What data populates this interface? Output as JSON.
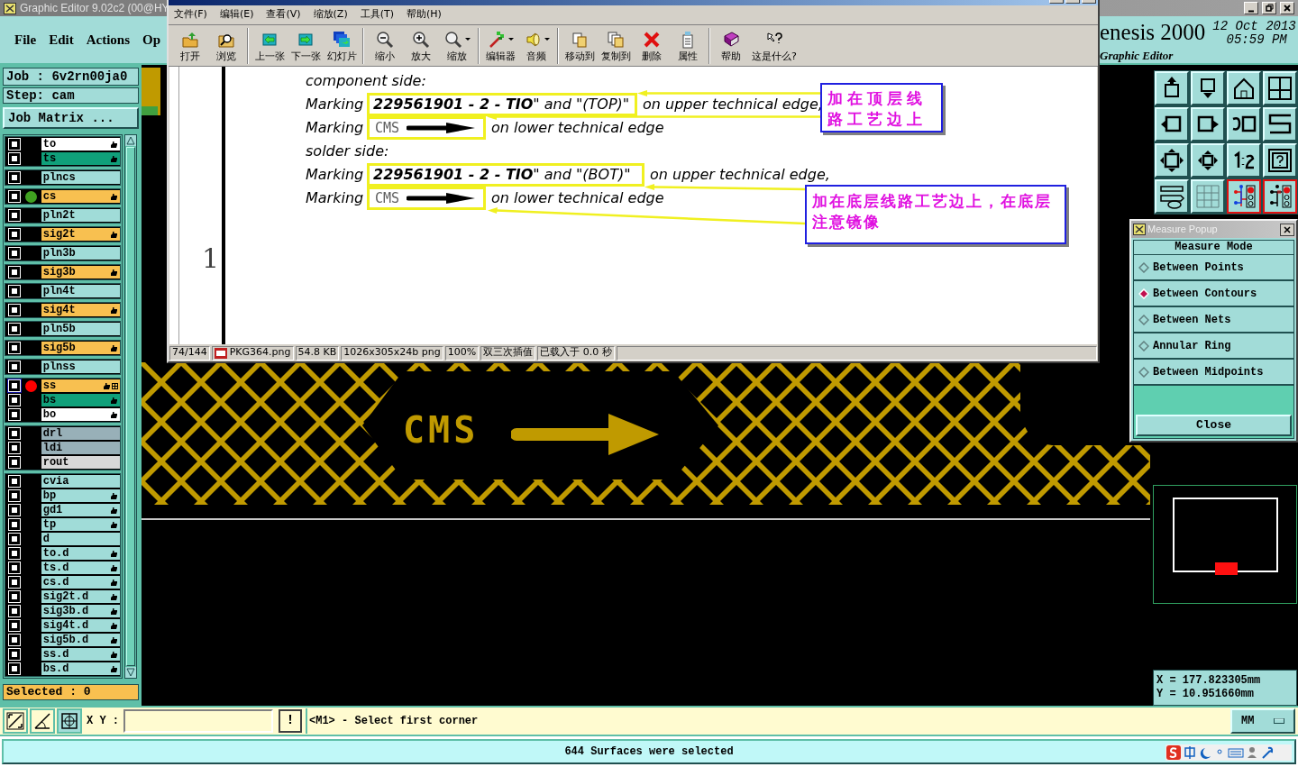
{
  "main_window": {
    "title": "Graphic Editor 9.02c2 (00@HY",
    "menu": [
      "File",
      "Edit",
      "Actions",
      "Op"
    ],
    "product": "enesis 2000",
    "date": "12 Oct 2013",
    "time": "05:59 PM",
    "subtitle": "Graphic Editor"
  },
  "job_panel": {
    "job": "Job : 6v2rn00ja0",
    "step": "Step: cam",
    "matrix_button": "Job Matrix ..."
  },
  "layer_groups": [
    [
      {
        "name": "to",
        "color": "#ffffff",
        "hand": true,
        "extra_icon": false,
        "selected": false
      },
      {
        "name": "ts",
        "color": "#10a07a",
        "hand": true,
        "extra_icon": false,
        "selected": false
      }
    ],
    [
      {
        "name": "plncs",
        "color": "#a0dcd8",
        "hand": false,
        "extra_icon": false,
        "selected": false
      }
    ],
    [
      {
        "name": "cs",
        "color": "#f8c050",
        "hand": true,
        "extra_icon": false,
        "selected": false,
        "dot": {
          "color": "#40a020"
        }
      }
    ],
    [
      {
        "name": "pln2t",
        "color": "#a0dcd8",
        "hand": false,
        "extra_icon": false,
        "selected": false
      }
    ],
    [
      {
        "name": "sig2t",
        "color": "#f8c050",
        "hand": true,
        "extra_icon": false,
        "selected": false
      }
    ],
    [
      {
        "name": "pln3b",
        "color": "#a0dcd8",
        "hand": false,
        "extra_icon": false,
        "selected": false
      }
    ],
    [
      {
        "name": "sig3b",
        "color": "#f8c050",
        "hand": true,
        "extra_icon": false,
        "selected": false
      }
    ],
    [
      {
        "name": "pln4t",
        "color": "#a0dcd8",
        "hand": false,
        "extra_icon": false,
        "selected": false
      }
    ],
    [
      {
        "name": "sig4t",
        "color": "#f8c050",
        "hand": true,
        "extra_icon": false,
        "selected": false
      }
    ],
    [
      {
        "name": "pln5b",
        "color": "#a0dcd8",
        "hand": false,
        "extra_icon": false,
        "selected": false
      }
    ],
    [
      {
        "name": "sig5b",
        "color": "#f8c050",
        "hand": true,
        "extra_icon": false,
        "selected": false
      }
    ],
    [
      {
        "name": "plnss",
        "color": "#a0dcd8",
        "hand": false,
        "extra_icon": false,
        "selected": false
      }
    ],
    [
      {
        "name": "ss",
        "color": "#f8c050",
        "hand": true,
        "extra_icon": true,
        "selected": true,
        "dot": {
          "color": "#ff0000"
        }
      },
      {
        "name": "bs",
        "color": "#10a07a",
        "hand": true,
        "extra_icon": false,
        "selected": false
      },
      {
        "name": "bo",
        "color": "#ffffff",
        "hand": true,
        "extra_icon": false,
        "selected": false
      }
    ],
    [
      {
        "name": "drl",
        "color": "#98b0b8",
        "hand": false,
        "extra_icon": false,
        "selected": false
      },
      {
        "name": "ldi",
        "color": "#98b0b8",
        "hand": false,
        "extra_icon": false,
        "selected": false
      },
      {
        "name": "rout",
        "color": "#d8d8d8",
        "hand": false,
        "extra_icon": false,
        "selected": false
      }
    ],
    [
      {
        "name": "cvia",
        "color": "#a0dcd8",
        "hand": false,
        "extra_icon": false,
        "selected": false
      },
      {
        "name": "bp",
        "color": "#a0dcd8",
        "hand": true,
        "extra_icon": false,
        "selected": false
      },
      {
        "name": "gd1",
        "color": "#a0dcd8",
        "hand": true,
        "extra_icon": false,
        "selected": false
      },
      {
        "name": "tp",
        "color": "#a0dcd8",
        "hand": true,
        "extra_icon": false,
        "selected": false
      },
      {
        "name": "d",
        "color": "#a0dcd8",
        "hand": false,
        "extra_icon": false,
        "selected": false
      },
      {
        "name": "to.d",
        "color": "#a0dcd8",
        "hand": true,
        "extra_icon": false,
        "selected": false
      },
      {
        "name": "ts.d",
        "color": "#a0dcd8",
        "hand": true,
        "extra_icon": false,
        "selected": false
      },
      {
        "name": "cs.d",
        "color": "#a0dcd8",
        "hand": true,
        "extra_icon": false,
        "selected": false
      },
      {
        "name": "sig2t.d",
        "color": "#a0dcd8",
        "hand": true,
        "extra_icon": false,
        "selected": false
      },
      {
        "name": "sig3b.d",
        "color": "#a0dcd8",
        "hand": true,
        "extra_icon": false,
        "selected": false
      },
      {
        "name": "sig4t.d",
        "color": "#a0dcd8",
        "hand": true,
        "extra_icon": false,
        "selected": false
      },
      {
        "name": "sig5b.d",
        "color": "#a0dcd8",
        "hand": true,
        "extra_icon": false,
        "selected": false
      },
      {
        "name": "ss.d",
        "color": "#a0dcd8",
        "hand": true,
        "extra_icon": false,
        "selected": false
      },
      {
        "name": "bs.d",
        "color": "#a0dcd8",
        "hand": true,
        "extra_icon": false,
        "selected": false
      }
    ]
  ],
  "selected_count": "Selected : 0",
  "canvas": {
    "marking": "CMS"
  },
  "tool_buttons": [
    {
      "highlighted": false
    },
    {
      "highlighted": false
    },
    {
      "highlighted": false
    },
    {
      "highlighted": false
    },
    {
      "highlighted": false
    },
    {
      "highlighted": false
    },
    {
      "highlighted": false
    },
    {
      "highlighted": false
    },
    {
      "highlighted": false
    },
    {
      "highlighted": false
    },
    {
      "highlighted": false
    },
    {
      "highlighted": false
    },
    {
      "highlighted": false
    },
    {
      "highlighted": false
    },
    {
      "highlighted": true
    },
    {
      "highlighted": true
    }
  ],
  "coordinates": {
    "x": "X = 177.823305mm",
    "y": "Y = 10.951660mm"
  },
  "command_bar": {
    "xy_label": "X Y :",
    "alert": "!",
    "message": "<M1> - Select first corner",
    "units": "MM"
  },
  "status": "644 Surfaces were selected",
  "viewer": {
    "menu": [
      "文件(F)",
      "编辑(E)",
      "查看(V)",
      "缩放(Z)",
      "工具(T)",
      "帮助(H)"
    ],
    "toolbar_groups": [
      [
        {
          "label": "打开",
          "dropdown": false
        },
        {
          "label": "浏览",
          "dropdown": false
        }
      ],
      [
        {
          "label": "上一张",
          "dropdown": false
        },
        {
          "label": "下一张",
          "dropdown": false
        },
        {
          "label": "幻灯片",
          "dropdown": false
        }
      ],
      [
        {
          "label": "缩小",
          "dropdown": false
        },
        {
          "label": "放大",
          "dropdown": false
        },
        {
          "label": "缩放",
          "dropdown": true
        }
      ],
      [
        {
          "label": "编辑器",
          "dropdown": true
        },
        {
          "label": "音频",
          "dropdown": true
        }
      ],
      [
        {
          "label": "移动到",
          "dropdown": false
        },
        {
          "label": "复制到",
          "dropdown": false
        },
        {
          "label": "删除",
          "dropdown": false
        },
        {
          "label": "属性",
          "dropdown": false
        }
      ],
      [
        {
          "label": "帮助",
          "dropdown": false
        },
        {
          "label": "这是什么?",
          "dropdown": false
        }
      ]
    ],
    "document": {
      "page_number": "1",
      "lines": [
        {
          "kind": "heading",
          "text": "component side:"
        },
        {
          "kind": "marking_text",
          "lead": "Marking",
          "boxed": "**229561901 - 2 - TIO**\" and \"(TOP)\"",
          "trail": "on upper technical edge,"
        },
        {
          "kind": "marking_arrow",
          "lead": "Marking",
          "boxed": "CMS",
          "trail": "on lower technical edge"
        },
        {
          "kind": "heading",
          "text": "solder side:"
        },
        {
          "kind": "marking_text",
          "lead": "Marking",
          "boxed": "**229561901 - 2 - TIO**\" and  \"(BOT)\"",
          "trail": "on upper technical edge,"
        },
        {
          "kind": "marking_arrow",
          "lead": "Marking",
          "boxed": "CMS",
          "trail": "on lower technical edge"
        }
      ],
      "callouts": [
        "加在顶层线路工艺边上",
        "加在底层线路工艺边上，在底层注意镜像"
      ]
    },
    "status_fields": [
      "74/144",
      "PKG364.png",
      "54.8 KB",
      "1026x305x24b png",
      "100%",
      "双三次插值",
      "已载入于 0.0 秒"
    ]
  },
  "measure_popup": {
    "title": "Measure Popup",
    "header": "Measure Mode",
    "options": [
      {
        "label": "Between Points",
        "selected": false
      },
      {
        "label": "Between Contours",
        "selected": true
      },
      {
        "label": "Between Nets",
        "selected": false
      },
      {
        "label": "Annular Ring",
        "selected": false
      },
      {
        "label": "Between Midpoints",
        "selected": false
      }
    ],
    "close": "Close"
  }
}
